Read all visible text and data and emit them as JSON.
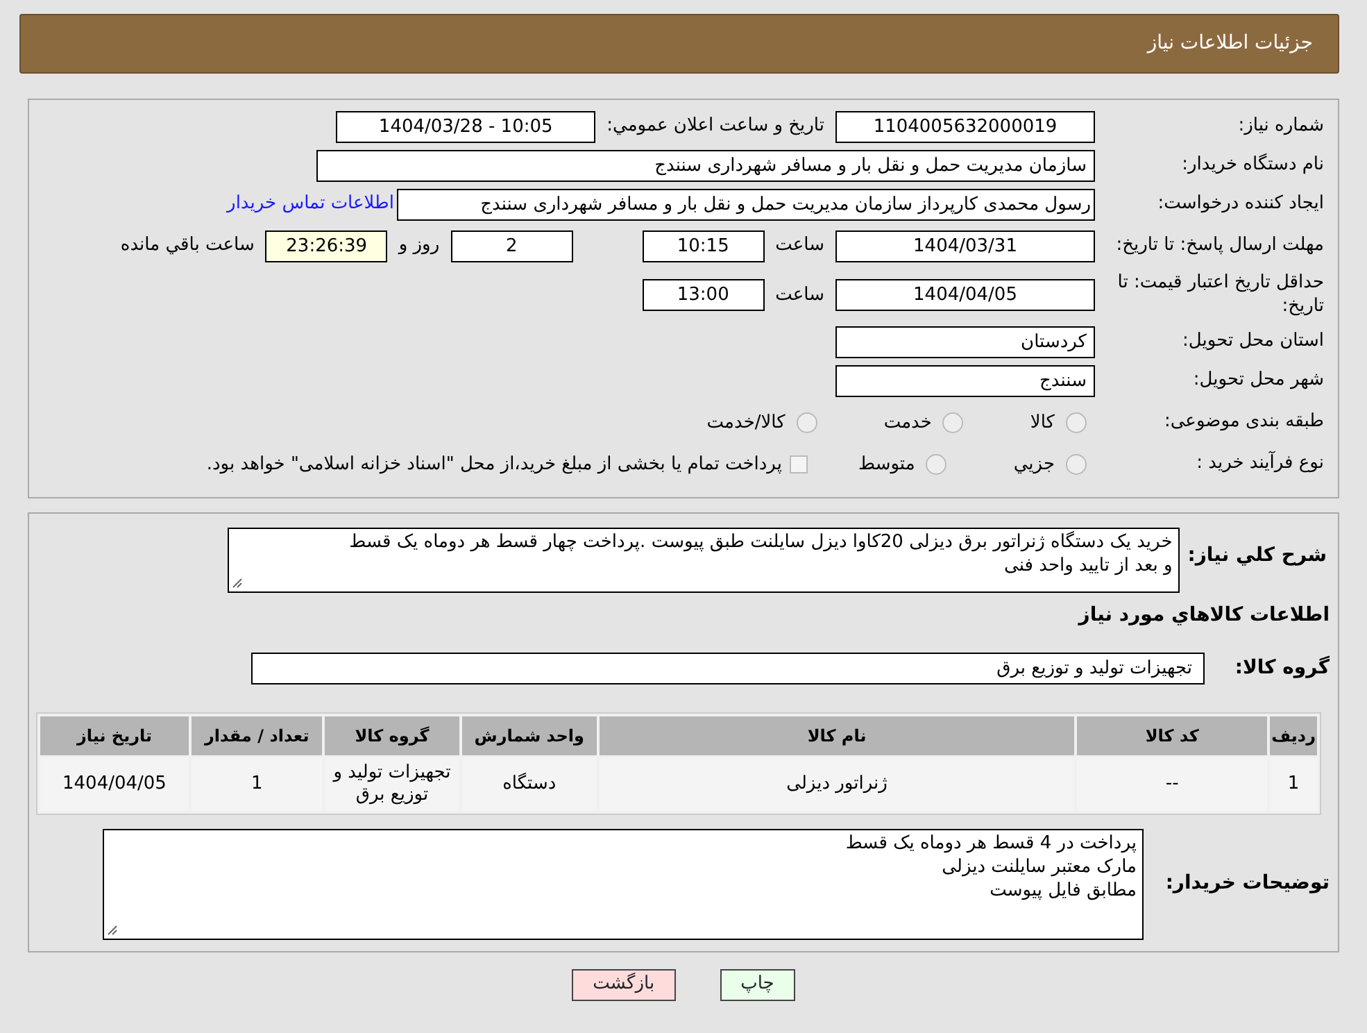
{
  "header": {
    "title": "جزئیات اطلاعات نیاز"
  },
  "details": {
    "need_number": {
      "label": "شماره نیاز:",
      "value": "1104005632000019"
    },
    "announce": {
      "label": "تاريخ و ساعت اعلان عمومي:",
      "value": "1404/03/28 - 10:05"
    },
    "buyer": {
      "label": "نام دستگاه خریدار:",
      "value": "سازمان مدیریت حمل و نقل بار و مسافر شهرداری سنندج"
    },
    "requester": {
      "label": "ایجاد کننده درخواست:",
      "value": "رسول محمدی کارپرداز سازمان مدیریت حمل و نقل بار و مسافر شهرداری سنندج",
      "link": "اطلاعات تماس خریدار"
    },
    "deadline": {
      "label": "مهلت ارسال پاسخ: تا تاریخ:",
      "date": "1404/03/31",
      "time_label": "ساعت",
      "time": "10:15",
      "days": "2",
      "days_label": "روز و",
      "remaining": "23:26:39",
      "remaining_label": "ساعت باقي مانده"
    },
    "validity": {
      "label": "حداقل تاریخ اعتبار قیمت: تا تاریخ:",
      "date": "1404/04/05",
      "time_label": "ساعت",
      "time": "13:00"
    },
    "province": {
      "label": "استان محل تحویل:",
      "value": "کردستان"
    },
    "city": {
      "label": "شهر محل تحویل:",
      "value": "سنندج"
    },
    "category": {
      "label": "طبقه بندی موضوعی:",
      "options": [
        {
          "label": "کالا",
          "selected": false
        },
        {
          "label": "خدمت",
          "selected": false
        },
        {
          "label": "کالا/خدمت",
          "selected": false
        }
      ]
    },
    "process": {
      "label": "نوع فرآیند خرید :",
      "options": [
        {
          "label": "جزيي",
          "selected": false
        },
        {
          "label": "متوسط",
          "selected": false
        }
      ],
      "note": "پرداخت تمام یا بخشی از مبلغ خرید،از محل \"اسناد خزانه اسلامی\" خواهد بود.",
      "note_checked": false
    }
  },
  "summary": {
    "label": "شرح کلي نياز:",
    "lines": [
      "خرید یک دستگاه ژنراتور برق دیزلی 20کاوا دیزل سایلنت طبق پیوست  .پرداخت چهار قسط هر دوماه یک قسط",
      "و بعد از تایید واحد فنی"
    ],
    "goods_title": "اطلاعات کالاهاي مورد نياز",
    "group": {
      "label": "گروه کالا:",
      "value": "تجهیزات تولید و توزیع برق"
    },
    "table": {
      "columns": [
        "ردیف",
        "کد کالا",
        "نام کالا",
        "واحد شمارش",
        "گروه کالا",
        "تعداد / مقدار",
        "تاريخ نياز"
      ],
      "rows": [
        [
          "1",
          "--",
          "ژنراتور دیزلی",
          "دستگاه",
          "تجهیزات تولید و توزیع برق",
          "1",
          "1404/04/05"
        ]
      ]
    },
    "notes": {
      "label": "توضیحات خریدار:",
      "lines": [
        "پرداخت در 4 قسط هر دوماه یک قسط",
        "مارک معتبر سایلنت دیزلی",
        "مطابق فایل پیوست"
      ]
    }
  },
  "buttons": [
    {
      "label": "چاپ",
      "kind": "print"
    },
    {
      "label": "بازگشت",
      "kind": "back"
    }
  ]
}
